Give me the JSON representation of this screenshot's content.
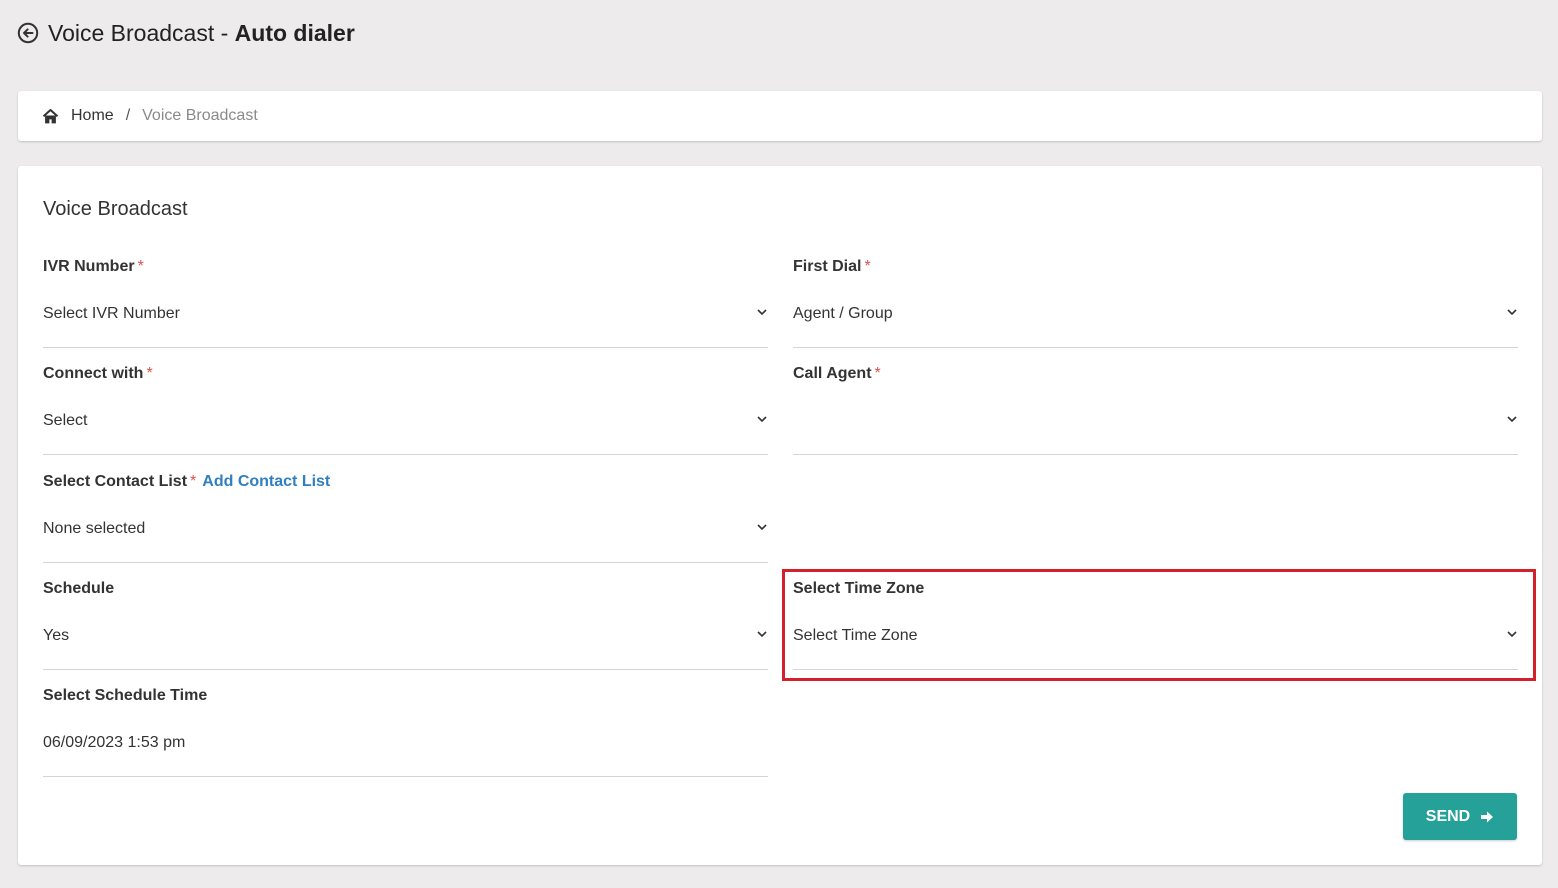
{
  "header": {
    "title_prefix": "Voice Broadcast - ",
    "title_bold": "Auto dialer",
    "back_icon": "arrow-circle-left-icon"
  },
  "breadcrumb": {
    "home_icon": "home-icon",
    "home_label": "Home",
    "separator": "/",
    "current": "Voice Broadcast"
  },
  "form": {
    "title": "Voice Broadcast",
    "required_mark": "*",
    "ivr_number": {
      "label": "IVR Number",
      "value": "Select IVR Number"
    },
    "first_dial": {
      "label": "First Dial",
      "value": "Agent / Group"
    },
    "connect_with": {
      "label": "Connect with",
      "value": "Select"
    },
    "call_agent": {
      "label": "Call Agent",
      "value": ""
    },
    "contact_list": {
      "label": "Select Contact List",
      "add_link": "Add Contact List",
      "value": "None selected"
    },
    "schedule": {
      "label": "Schedule",
      "value": "Yes"
    },
    "time_zone": {
      "label": "Select Time Zone",
      "value": "Select Time Zone"
    },
    "schedule_time": {
      "label": "Select Schedule Time",
      "value": "06/09/2023 1:53 pm"
    },
    "send_label": "SEND"
  },
  "colors": {
    "accent": "#26a199",
    "link": "#2f7fc1",
    "required": "#d9534f",
    "highlight": "#d41f2c"
  }
}
